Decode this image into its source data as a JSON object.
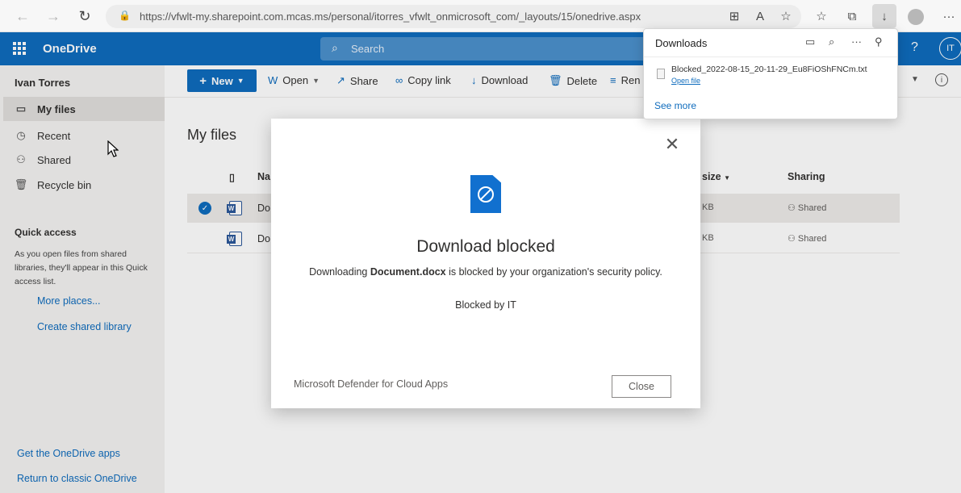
{
  "browser": {
    "url": "https://vfwlt-my.sharepoint.com.mcas.ms/personal/itorres_vfwlt_onmicrosoft_com/_layouts/15/onedrive.aspx",
    "back_icon": "←",
    "forward_icon": "→",
    "refresh_icon": "↻",
    "lock_icon": "🔒",
    "more_icon": "···"
  },
  "suite": {
    "app_name": "OneDrive",
    "search_placeholder": "Search",
    "help": "?",
    "user_initials": "IT"
  },
  "leftnav": {
    "user": "Ivan Torres",
    "items": [
      {
        "label": "My files",
        "icon": "folder-icon"
      },
      {
        "label": "Recent",
        "icon": "clock-icon"
      },
      {
        "label": "Shared",
        "icon": "people-icon"
      },
      {
        "label": "Recycle bin",
        "icon": "trash-icon"
      }
    ],
    "quick_access_title": "Quick access",
    "quick_access_desc": "As you open files from shared libraries, they'll appear in this Quick access list.",
    "more_places": "More places...",
    "create_library": "Create shared library",
    "get_apps": "Get the OneDrive apps",
    "classic": "Return to classic OneDrive"
  },
  "commands": {
    "new": "New",
    "open": "Open",
    "share": "Share",
    "copy_link": "Copy link",
    "download": "Download",
    "delete": "Delete",
    "rename": "Ren"
  },
  "main": {
    "title": "My files",
    "columns": {
      "name": "Na",
      "size": "size",
      "sharing": "Sharing"
    },
    "rows": [
      {
        "name": "Do",
        "size": "KB",
        "sharing": "Shared",
        "selected": true
      },
      {
        "name": "Do",
        "size": "KB",
        "sharing": "Shared",
        "selected": false
      }
    ]
  },
  "modal": {
    "title": "Download blocked",
    "msg_pre": "Downloading ",
    "msg_file": "Document.docx",
    "msg_post": " is blocked by your organization's security policy.",
    "blocked_by": "Blocked by IT",
    "footer": "Microsoft Defender for Cloud Apps",
    "close_label": "Close"
  },
  "downloads": {
    "title": "Downloads",
    "file": "Blocked_2022-08-15_20-11-29_Eu8FiOShFNCm.txt",
    "open_file": "Open file",
    "see_more": "See more"
  },
  "colors": {
    "accent": "#0f6cbd",
    "word": "#2b579a"
  }
}
